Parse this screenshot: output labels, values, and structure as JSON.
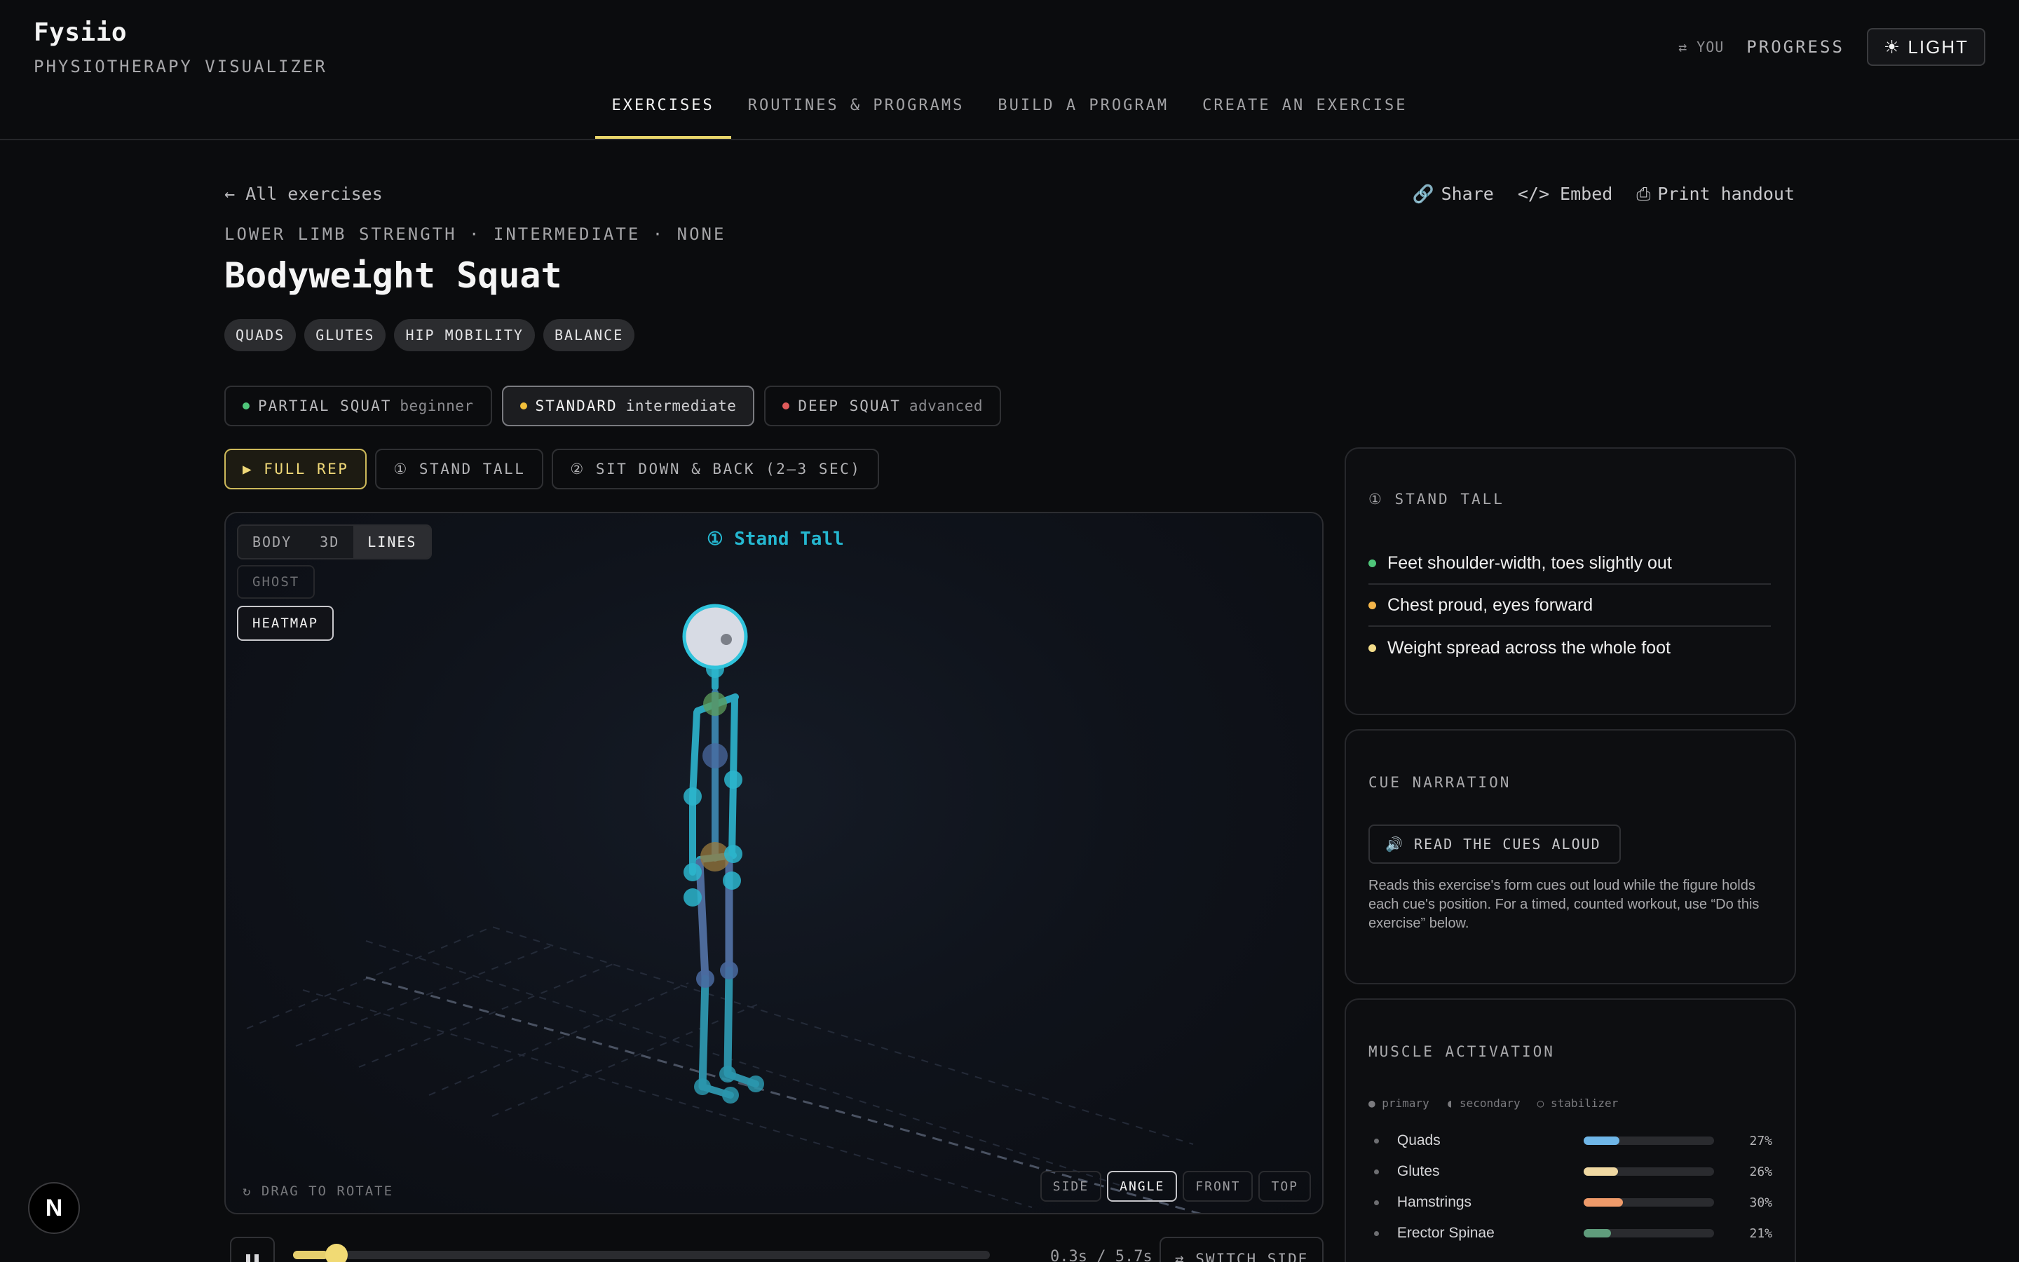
{
  "brand": {
    "name": "Fysiio",
    "subtitle": "PHYSIOTHERAPY VISUALIZER"
  },
  "header": {
    "you_label": "⇄ YOU",
    "progress_label": "PROGRESS",
    "theme_label": "☀ LIGHT"
  },
  "nav": {
    "tabs": [
      "EXERCISES",
      "ROUTINES & PROGRAMS",
      "BUILD A PROGRAM",
      "CREATE AN EXERCISE"
    ],
    "active": "EXERCISES"
  },
  "page": {
    "back_label": "← All exercises",
    "actions": {
      "share": "Share",
      "embed": "</> Embed",
      "print": "Print handout"
    },
    "meta": "LOWER LIMB STRENGTH · INTERMEDIATE · NONE",
    "title": "Bodyweight Squat",
    "tags": [
      "QUADS",
      "GLUTES",
      "HIP MOBILITY",
      "BALANCE"
    ]
  },
  "variants": [
    {
      "name": "PARTIAL SQUAT",
      "level": "beginner",
      "color": "#4fc67a"
    },
    {
      "name": "STANDARD",
      "level": "intermediate",
      "color": "#f1bf3a"
    },
    {
      "name": "DEEP SQUAT",
      "level": "advanced",
      "color": "#e05b5b"
    }
  ],
  "phases": [
    "▶ FULL REP",
    "① STAND TALL",
    "② SIT DOWN & BACK (2–3 SEC)"
  ],
  "viewer": {
    "modes": [
      "BODY",
      "3D",
      "LINES"
    ],
    "active_mode": "LINES",
    "ghost_label": "GHOST",
    "heatmap_label": "HEATMAP",
    "stage_label": "① Stand Tall",
    "drag_hint": "↻ DRAG TO ROTATE",
    "views": [
      "SIDE",
      "ANGLE",
      "FRONT",
      "TOP"
    ],
    "active_view": "ANGLE"
  },
  "playback": {
    "time": "0.3s / 5.7s",
    "progress": 0.05,
    "switch_label": "⇄ SWITCH SIDE"
  },
  "cues_card": {
    "title": "① STAND TALL",
    "cues": [
      {
        "text": "Feet shoulder-width, toes slightly out",
        "color": "#4fc67a"
      },
      {
        "text": "Chest proud, eyes forward",
        "color": "#f3b54a"
      },
      {
        "text": "Weight spread across the whole foot",
        "color": "#f3dc8a"
      }
    ]
  },
  "narration": {
    "title": "CUE NARRATION",
    "button": "🔊 READ THE CUES ALOUD",
    "text": "Reads this exercise's form cues out loud while the figure holds each cue's position. For a timed, counted workout, use “Do this exercise” below."
  },
  "activation": {
    "title": "MUSCLE ACTIVATION",
    "legend": [
      "● primary",
      "◖ secondary",
      "○ stabilizer"
    ],
    "muscles": [
      {
        "name": "Quads",
        "value": 27,
        "pct": "27%",
        "color": "#6fb6e8"
      },
      {
        "name": "Glutes",
        "value": 26,
        "pct": "26%",
        "color": "#efd8a2"
      },
      {
        "name": "Hamstrings",
        "value": 30,
        "pct": "30%",
        "color": "#ee9a6a"
      },
      {
        "name": "Erector Spinae",
        "value": 21,
        "pct": "21%",
        "color": "#5f9c7c"
      }
    ]
  },
  "badge": {
    "letter": "N"
  }
}
